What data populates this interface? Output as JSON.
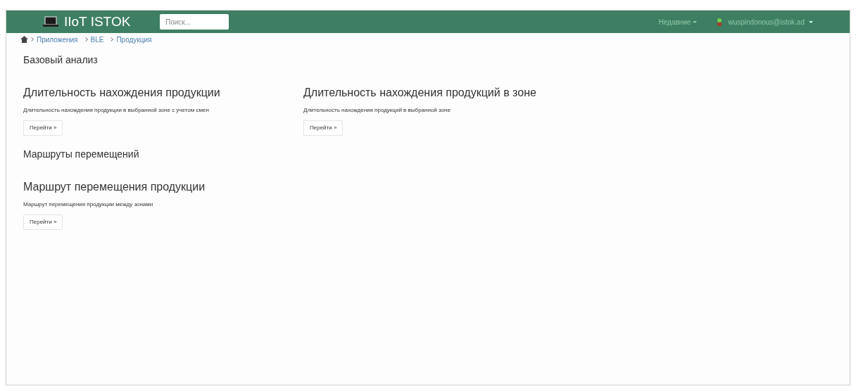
{
  "header": {
    "logo": "IIoT ISTOK",
    "search": {
      "placeholder": "Поиск..."
    },
    "recent": "Недавние",
    "user": "wuspindonous@istok.ad"
  },
  "breadcrumb": [
    "Приложения",
    "BLE",
    "Продукция"
  ],
  "sections": [
    {
      "title": "Базовый анализ",
      "cards": [
        {
          "title": "Длительность нахождения продукции",
          "description": "Длительность нахождения продукции в выбранной зоне с учетом смен",
          "button": "Перейти »"
        },
        {
          "title": "Длительность нахождения продукций в зоне",
          "description": "Длительность нахождения продукций в выбранной зоне",
          "button": "Перейти »"
        }
      ]
    },
    {
      "title": "Маршруты перемещений",
      "cards": [
        {
          "title": "Маршрут перемещения продукции",
          "description": "Маршрут перемещения продукции между зонами",
          "button": "Перейти »"
        }
      ]
    }
  ]
}
